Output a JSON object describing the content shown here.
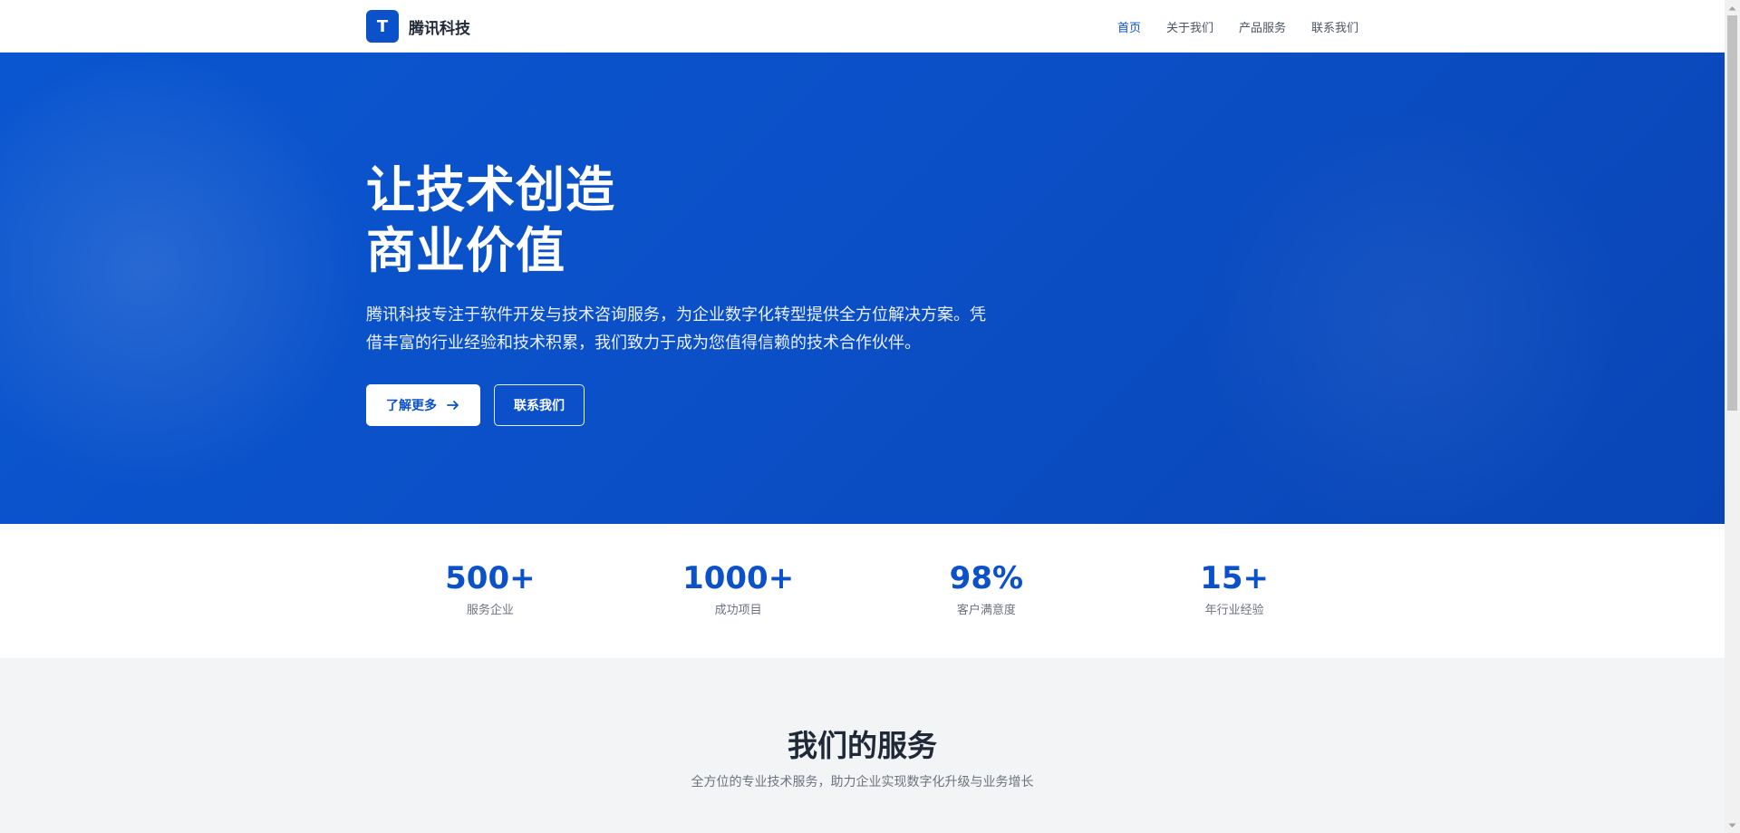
{
  "header": {
    "logo_letter": "T",
    "brand_name": "腾讯科技",
    "nav": [
      {
        "label": "首页",
        "active": true
      },
      {
        "label": "关于我们",
        "active": false
      },
      {
        "label": "产品服务",
        "active": false
      },
      {
        "label": "联系我们",
        "active": false
      }
    ]
  },
  "hero": {
    "title_line1": "让技术创造",
    "title_line2": "商业价值",
    "description": "腾讯科技专注于软件开发与技术咨询服务，为企业数字化转型提供全方位解决方案。凭借丰富的行业经验和技术积累，我们致力于成为您值得信赖的技术合作伙伴。",
    "primary_button": "了解更多",
    "secondary_button": "联系我们"
  },
  "stats": [
    {
      "value": "500+",
      "label": "服务企业"
    },
    {
      "value": "1000+",
      "label": "成功项目"
    },
    {
      "value": "98%",
      "label": "客户满意度"
    },
    {
      "value": "15+",
      "label": "年行业经验"
    }
  ],
  "services": {
    "title": "我们的服务",
    "subtitle": "全方位的专业技术服务，助力企业实现数字化升级与业务增长"
  },
  "colors": {
    "brand": "#0b51c9",
    "hero_background": "#0a4fc7",
    "services_background": "#f3f4f6"
  },
  "icons": {
    "primary_button_icon": "arrow-right-icon"
  }
}
